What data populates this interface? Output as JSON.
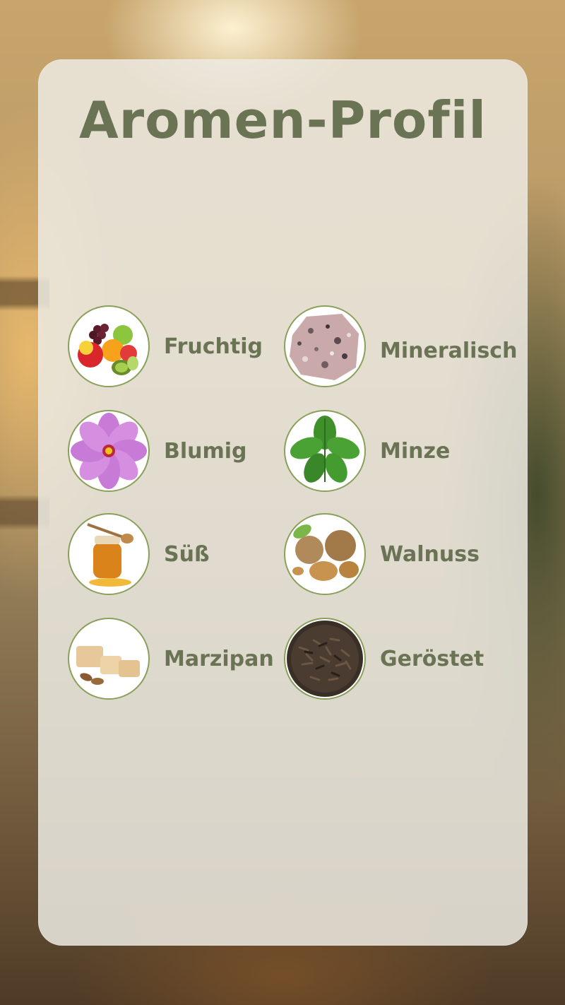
{
  "title": "Aromen-Profil",
  "items": [
    {
      "label": "Fruchtig",
      "icon": "fruits-icon"
    },
    {
      "label": "Mineralisch",
      "icon": "mineral-rock-icon"
    },
    {
      "label": "Blumig",
      "icon": "flower-icon"
    },
    {
      "label": "Minze",
      "icon": "mint-leaf-icon"
    },
    {
      "label": "Süß",
      "icon": "honey-jar-icon"
    },
    {
      "label": "Walnuss",
      "icon": "walnut-icon"
    },
    {
      "label": "Marzipan",
      "icon": "marzipan-icon"
    },
    {
      "label": "Geröstet",
      "icon": "roasted-icon"
    }
  ],
  "colors": {
    "text": "#6b7355",
    "circle_border": "#8aa05a",
    "card": "#eceae2"
  }
}
